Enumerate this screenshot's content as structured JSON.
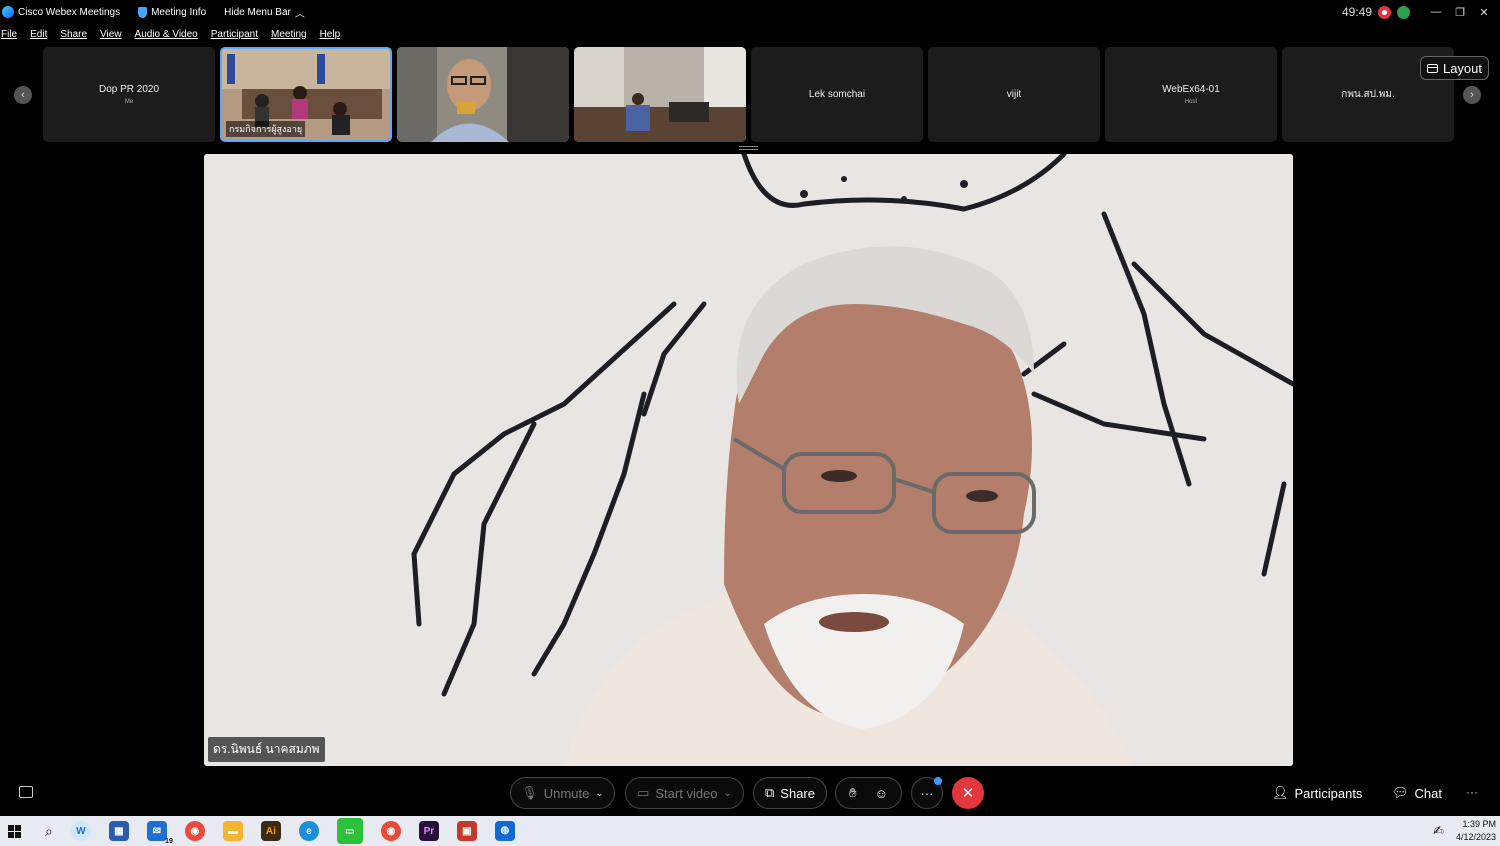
{
  "titlebar": {
    "app_name": "Cisco Webex Meetings",
    "meeting_info": "Meeting Info",
    "hide_menu_bar": "Hide Menu Bar",
    "timer": "49:49"
  },
  "menu": [
    "File",
    "Edit",
    "Share",
    "View",
    "Audio & Video",
    "Participant",
    "Meeting",
    "Help"
  ],
  "filmstrip": {
    "tiles": [
      {
        "name": "Dop PR 2020",
        "sub": "Me",
        "video": false
      },
      {
        "name": "",
        "label": "กรมกิจการผู้สูงอายุ",
        "video": true,
        "active": true
      },
      {
        "name": "",
        "video": true
      },
      {
        "name": "",
        "video": true
      },
      {
        "name": "Lek somchai",
        "sub": "",
        "video": false
      },
      {
        "name": "vijit",
        "sub": "",
        "video": false
      },
      {
        "name": "WebEx64-01",
        "sub": "Host",
        "video": false
      },
      {
        "name": "กพน.สป.พม.",
        "sub": "",
        "video": false
      }
    ],
    "layout_label": "Layout"
  },
  "main_video": {
    "speaker_label": "ดร.นิพนธ์ นาคสมภพ"
  },
  "controls": {
    "unmute": "Unmute",
    "start_video": "Start video",
    "share": "Share",
    "participants": "Participants",
    "chat": "Chat"
  },
  "taskbar": {
    "mail_badge": "19",
    "time": "1:39 PM",
    "date": "4/12/2023"
  },
  "colors": {
    "accent": "#5aa8ff",
    "end_call": "#e2373f",
    "recording": "#e2373f",
    "network": "#2ea04a"
  }
}
